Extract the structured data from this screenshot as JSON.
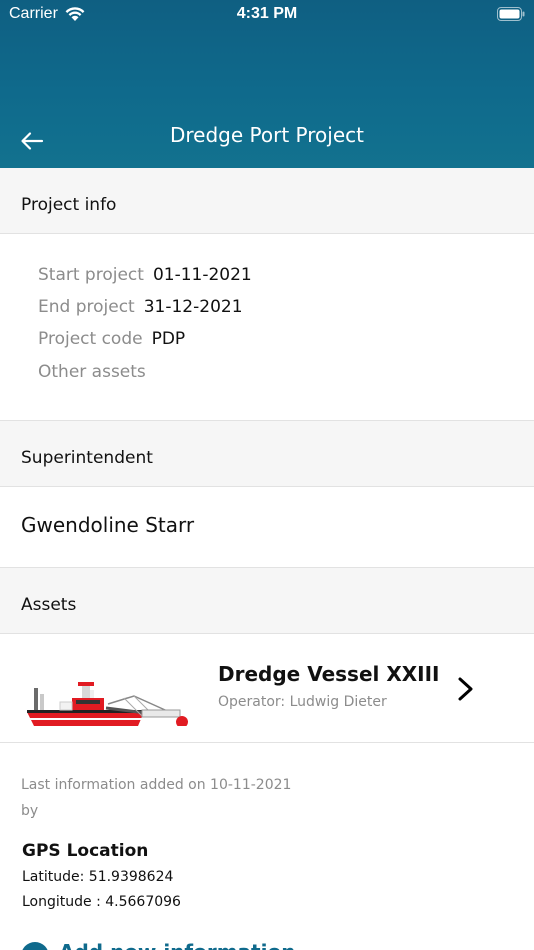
{
  "status_bar": {
    "carrier": "Carrier",
    "time": "4:31 PM"
  },
  "nav": {
    "title": "Dredge Port Project"
  },
  "sections": {
    "project_info": "Project info",
    "superintendent": "Superintendent",
    "assets": "Assets"
  },
  "project_info": {
    "rows": [
      {
        "label": "Start project",
        "value": "01-11-2021"
      },
      {
        "label": "End project",
        "value": "31-12-2021"
      },
      {
        "label": "Project code",
        "value": "PDP"
      },
      {
        "label": "Other assets",
        "value": ""
      }
    ]
  },
  "superintendent": {
    "name": "Gwendoline Starr"
  },
  "asset": {
    "name": "Dredge Vessel XXIII",
    "operator": "Operator: Ludwig Dieter"
  },
  "last_info": {
    "line1": "Last information added on 10-11-2021",
    "line2": "by"
  },
  "gps": {
    "title": "GPS Location",
    "latitude": "Latitude: 51.9398624",
    "longitude": "Longitude : 4.5667096"
  },
  "add_info": {
    "label": "Add new information"
  },
  "colors": {
    "header": "#0f6a8c",
    "accent": "#0f6a8c",
    "section_bg": "#f6f6f6"
  }
}
